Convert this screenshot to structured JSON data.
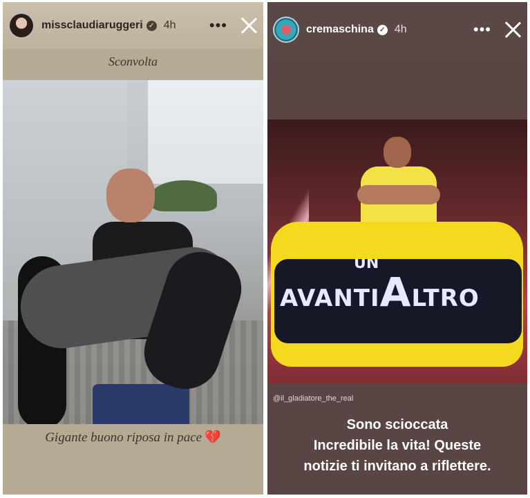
{
  "left_story": {
    "username": "missclaudiaruggeri",
    "time": "4h",
    "caption_top": "Sconvolta",
    "caption_bottom": "Gigante buono riposa in pace",
    "caption_emoji": "💔"
  },
  "right_story": {
    "username": "cremaschina",
    "time": "4h",
    "screen_text": {
      "un": "UN",
      "line": "AVANTI",
      "a": "A",
      "rest": "LTRO"
    },
    "mention": "@il_gladiatore_the_real",
    "message_lines": [
      "Sono scioccata",
      "Incredibile la vita! Queste",
      "notizie ti invitano a riflettere."
    ]
  },
  "icons": {
    "verified": "✓",
    "more": "•••"
  }
}
